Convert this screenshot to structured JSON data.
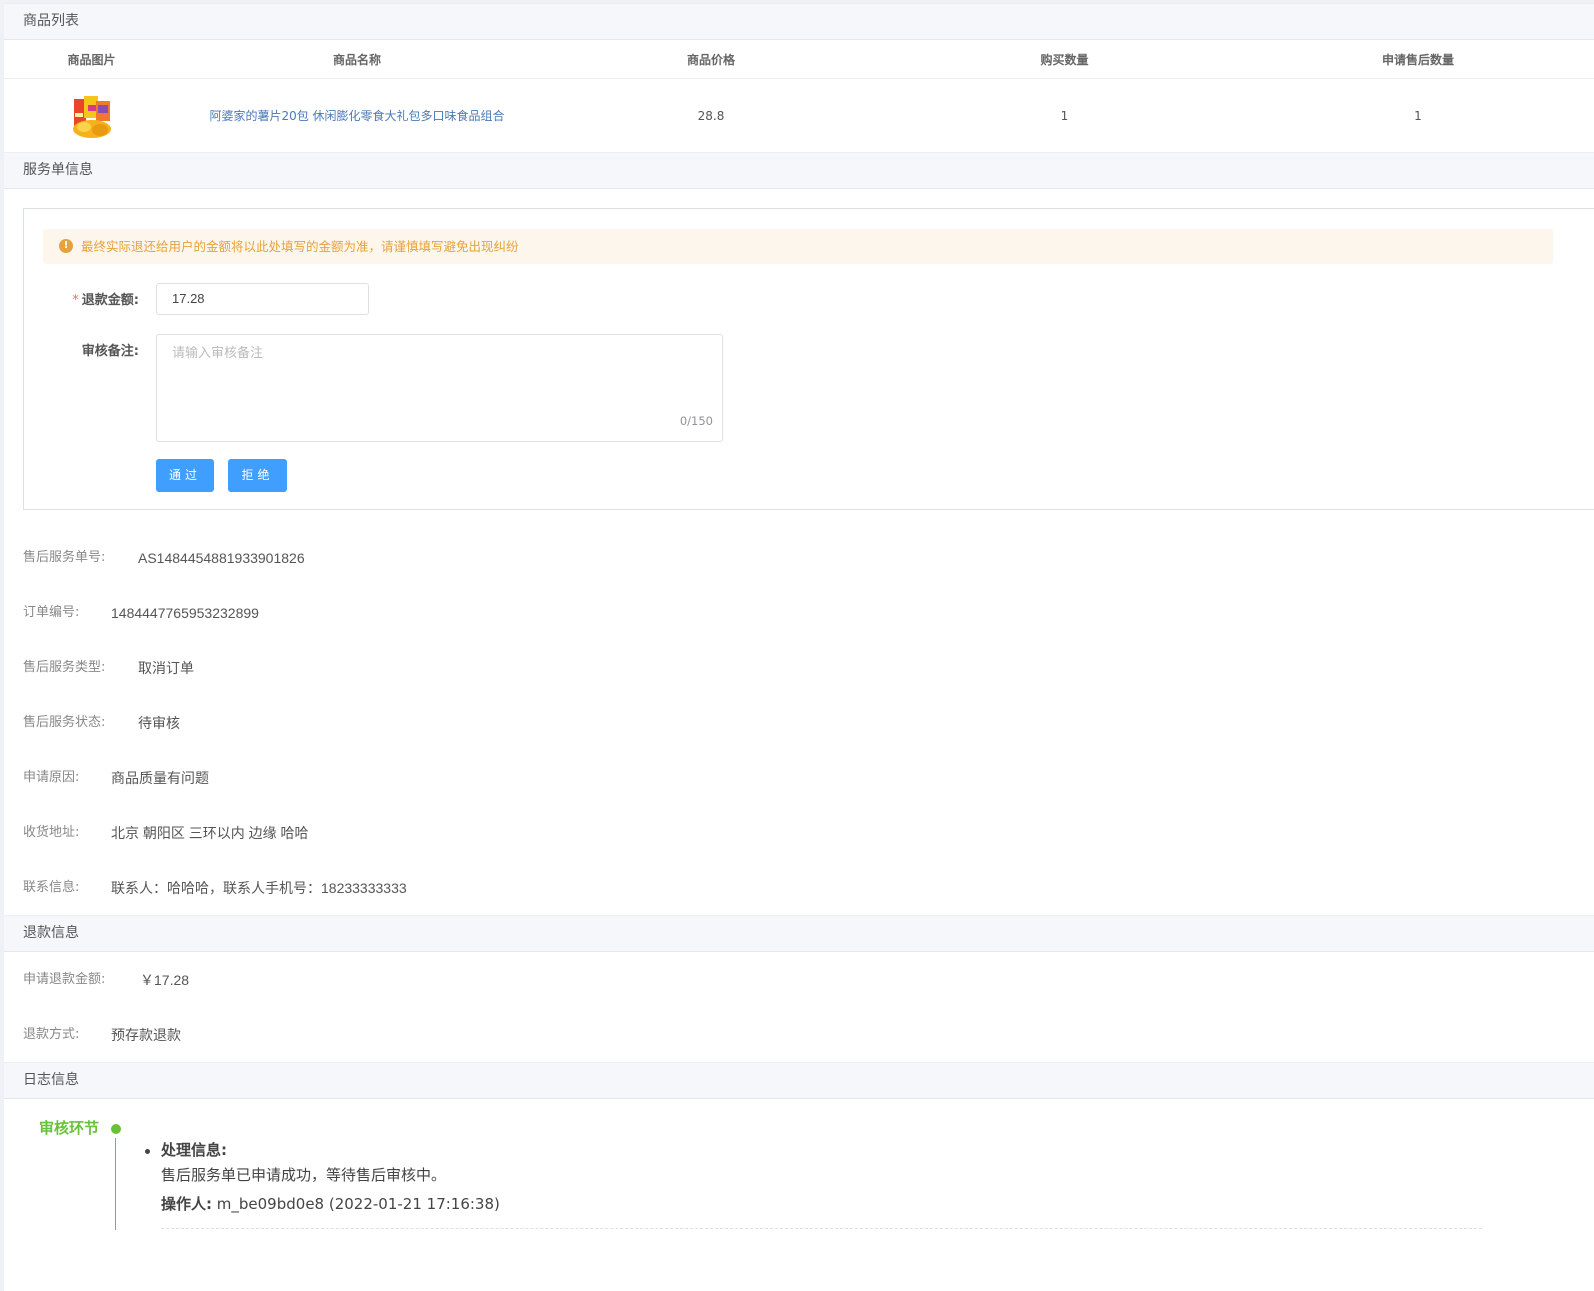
{
  "goods_section": {
    "title": "商品列表",
    "headers": [
      "商品图片",
      "商品名称",
      "商品价格",
      "购买数量",
      "申请售后数量"
    ],
    "rows": [
      {
        "image": "snack-product-image",
        "name": "阿婆家的薯片20包 休闲膨化零食大礼包多口味食品组合",
        "price": "28.8",
        "qty": "1",
        "after_sale_qty": "1"
      }
    ]
  },
  "service_section": {
    "title": "服务单信息",
    "alert": "最终实际退还给用户的金额将以此处填写的金额为准，请谨慎填写避免出现纠纷",
    "refund_label": "退款金额:",
    "refund_required_mark": "*",
    "refund_value": "17.28",
    "remark_label": "审核备注:",
    "remark_placeholder": "请输入审核备注",
    "remark_count": "0/150",
    "approve_button": "通过",
    "reject_button": "拒绝",
    "info": [
      {
        "key": "售后服务单号:",
        "value": "AS1484454881933901826"
      },
      {
        "key": "订单编号:",
        "value": "1484447765953232899"
      },
      {
        "key": "售后服务类型:",
        "value": "取消订单"
      },
      {
        "key": "售后服务状态:",
        "value": "待审核"
      },
      {
        "key": "申请原因:",
        "value": "商品质量有问题"
      },
      {
        "key": "收货地址:",
        "value": "北京 朝阳区 三环以内 边缘 哈哈"
      },
      {
        "key": "联系信息:",
        "value": "联系人：哈哈哈，联系人手机号：18233333333"
      }
    ]
  },
  "refund_section": {
    "title": "退款信息",
    "info": [
      {
        "key": "申请退款金额:",
        "value": "￥17.28"
      },
      {
        "key": "退款方式:",
        "value": "预存款退款"
      }
    ]
  },
  "log_section": {
    "title": "日志信息",
    "step": "审核环节",
    "process_label": "处理信息:",
    "process_text": "售后服务单已申请成功，等待售后审核中。",
    "operator_label": "操作人:",
    "operator_value": "m_be09bd0e8 (2022-01-21 17:16:38)"
  },
  "colors": {
    "primary": "#409eff",
    "warning": "#e6a23c",
    "success": "#67c23a",
    "link": "#4a7ab8"
  }
}
